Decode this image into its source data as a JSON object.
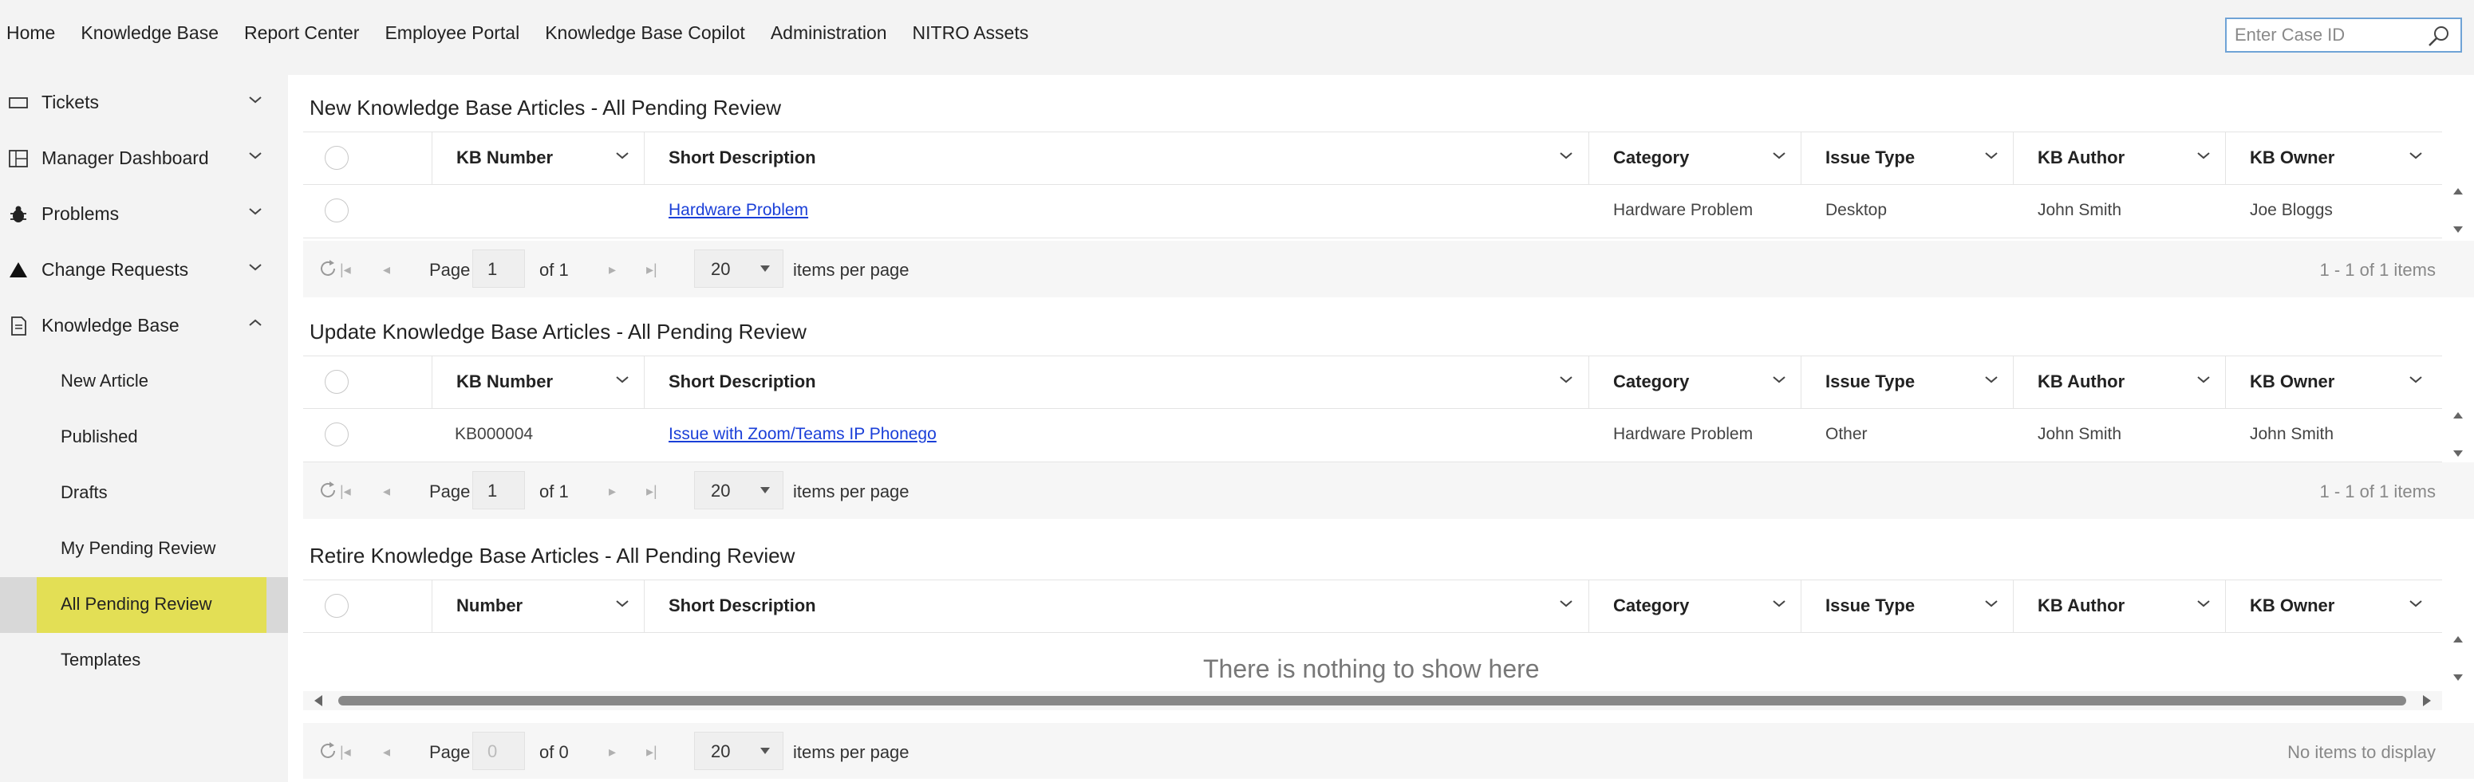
{
  "nav": {
    "links": [
      "Home",
      "Knowledge Base",
      "Report Center",
      "Employee Portal",
      "Knowledge Base Copilot",
      "Administration",
      "NITRO Assets"
    ],
    "case_search_placeholder": "Enter Case ID"
  },
  "sidebar": {
    "sections": [
      {
        "label": "Tickets",
        "icon": "ticket-icon",
        "expanded": false
      },
      {
        "label": "Manager Dashboard",
        "icon": "dashboard-icon",
        "expanded": false
      },
      {
        "label": "Problems",
        "icon": "bug-icon",
        "expanded": false
      },
      {
        "label": "Change Requests",
        "icon": "triangle-icon",
        "expanded": false
      },
      {
        "label": "Knowledge Base",
        "icon": "document-icon",
        "expanded": true
      }
    ],
    "kb_items": [
      "New Article",
      "Published",
      "Drafts",
      "My Pending Review",
      "All Pending Review",
      "Templates"
    ],
    "active_item": "All Pending Review",
    "active_color": "#e3df55"
  },
  "grids": [
    {
      "title": "New Knowledge Base Articles - All Pending Review",
      "columns": [
        "KB Number",
        "Short Description",
        "Category",
        "Issue Type",
        "KB Author",
        "KB Owner"
      ],
      "rows": [
        {
          "kb_number": "",
          "short_description": "Hardware Problem",
          "category": "Hardware Problem",
          "issue_type": "Desktop",
          "kb_author": "John Smith",
          "kb_owner": "Joe Bloggs"
        }
      ],
      "pager": {
        "page_label": "Page",
        "page": "1",
        "of": "of 1",
        "per_page": "20",
        "per_page_label": "items per page",
        "info": "1 - 1 of 1 items"
      }
    },
    {
      "title": "Update Knowledge Base Articles - All Pending Review",
      "columns": [
        "KB Number",
        "Short Description",
        "Category",
        "Issue Type",
        "KB Author",
        "KB Owner"
      ],
      "rows": [
        {
          "kb_number": "KB000004",
          "short_description": "Issue with Zoom/Teams IP Phonego",
          "category": "Hardware Problem",
          "issue_type": "Other",
          "kb_author": "John Smith",
          "kb_owner": "John Smith"
        }
      ],
      "pager": {
        "page_label": "Page",
        "page": "1",
        "of": "of 1",
        "per_page": "20",
        "per_page_label": "items per page",
        "info": "1 - 1 of 1 items"
      }
    },
    {
      "title": "Retire Knowledge Base Articles - All Pending Review",
      "columns": [
        "Number",
        "Short Description",
        "Category",
        "Issue Type",
        "KB Author",
        "KB Owner"
      ],
      "rows": [],
      "empty_message": "There is nothing to show here",
      "pager": {
        "page_label": "Page",
        "page": "0",
        "of": "of 0",
        "per_page": "20",
        "per_page_label": "items per page",
        "info": "No items to display"
      }
    }
  ],
  "colors": {
    "link": "#1a3fd8",
    "nav_bg": "#f3f3f3",
    "search_border": "#6fa3d6"
  }
}
